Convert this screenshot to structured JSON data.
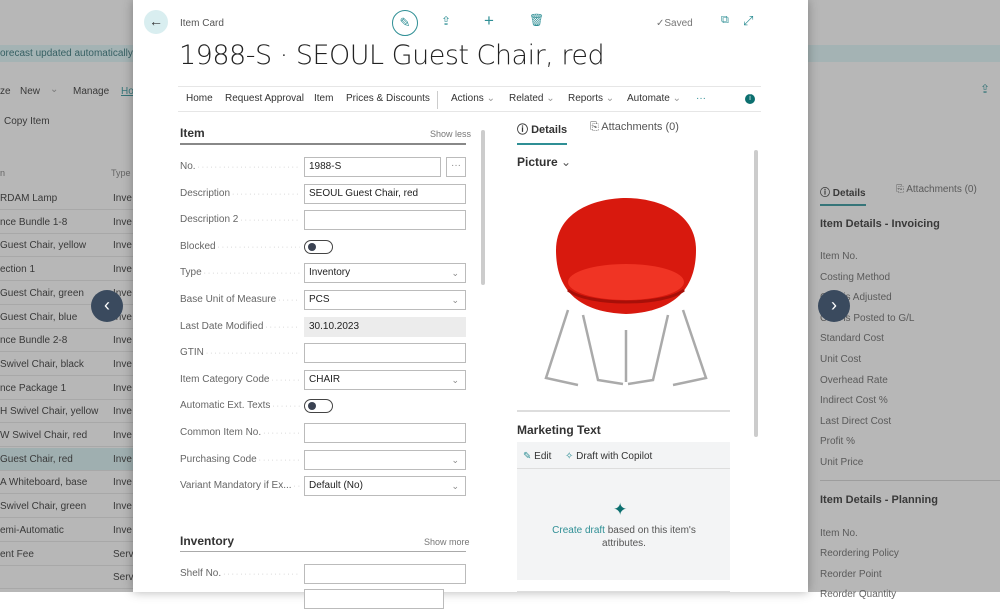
{
  "background_list": {
    "banner": "orecast updated automatically",
    "toolbar": [
      "ze",
      "New",
      "Manage",
      "Ho"
    ],
    "copy_item": "Copy Item",
    "columns": [
      "n",
      "Type"
    ],
    "rows": [
      {
        "d": "RDAM Lamp",
        "t": "Inve"
      },
      {
        "d": "nce Bundle 1-8",
        "t": "Inve"
      },
      {
        "d": "Guest Chair, yellow",
        "t": "Inve"
      },
      {
        "d": "ection 1",
        "t": "Inve"
      },
      {
        "d": "Guest Chair, green",
        "t": "Inve"
      },
      {
        "d": "Guest Chair, blue",
        "t": "Inve"
      },
      {
        "d": "nce Bundle 2-8",
        "t": "Inve"
      },
      {
        "d": "Swivel Chair, black",
        "t": "Inve"
      },
      {
        "d": "nce Package 1",
        "t": "Inve"
      },
      {
        "d": "H Swivel Chair, yellow",
        "t": "Inve"
      },
      {
        "d": "W Swivel Chair, red",
        "t": "Inve"
      },
      {
        "d": "Guest Chair, red",
        "t": "Inve"
      },
      {
        "d": "A Whiteboard, base",
        "t": "Inve"
      },
      {
        "d": "Swivel Chair, green",
        "t": "Inve"
      },
      {
        "d": "emi-Automatic",
        "t": "Inve"
      },
      {
        "d": "ent Fee",
        "t": "Serv"
      },
      {
        "d": "",
        "t": "Serv"
      }
    ]
  },
  "background_factbox": {
    "tabs": [
      "Details",
      "Attachments (0)"
    ],
    "invoicing_title": "Item Details - Invoicing",
    "invoicing_fields": [
      "Item No.",
      "Costing Method",
      "Cost is Adjusted",
      "Cost is Posted to G/L",
      "Standard Cost",
      "Unit Cost",
      "Overhead Rate",
      "Indirect Cost %",
      "Last Direct Cost",
      "Profit %",
      "Unit Price"
    ],
    "planning_title": "Item Details - Planning",
    "planning_fields": [
      "Item No.",
      "Reordering Policy",
      "Reorder Point",
      "Reorder Quantity"
    ]
  },
  "card": {
    "breadcrumb": "Item Card",
    "saved": "Saved",
    "title": "1988-S · SEOUL Guest Chair, red",
    "actions": [
      "Home",
      "Request Approval",
      "Item",
      "Prices & Discounts",
      "Actions",
      "Related",
      "Reports",
      "Automate"
    ],
    "more": "···",
    "item_section": {
      "title": "Item",
      "toggle": "Show less"
    },
    "fields": [
      {
        "label": "No.",
        "value": "1988-S",
        "kind": "lookup"
      },
      {
        "label": "Description",
        "value": "SEOUL Guest Chair, red",
        "kind": "text"
      },
      {
        "label": "Description 2",
        "value": "",
        "kind": "text"
      },
      {
        "label": "Blocked",
        "value": "off",
        "kind": "toggle"
      },
      {
        "label": "Type",
        "value": "Inventory",
        "kind": "select"
      },
      {
        "label": "Base Unit of Measure",
        "value": "PCS",
        "kind": "select"
      },
      {
        "label": "Last Date Modified",
        "value": "30.10.2023",
        "kind": "readonly"
      },
      {
        "label": "GTIN",
        "value": "",
        "kind": "text"
      },
      {
        "label": "Item Category Code",
        "value": "CHAIR",
        "kind": "select"
      },
      {
        "label": "Automatic Ext. Texts",
        "value": "off",
        "kind": "toggle"
      },
      {
        "label": "Common Item No.",
        "value": "",
        "kind": "text"
      },
      {
        "label": "Purchasing Code",
        "value": "",
        "kind": "select"
      },
      {
        "label": "Variant Mandatory if Ex...",
        "value": "Default (No)",
        "kind": "select"
      }
    ],
    "inventory_section": {
      "title": "Inventory",
      "toggle": "Show more"
    },
    "shelf_label": "Shelf No.",
    "factbox": {
      "tabs": [
        "Details",
        "Attachments (0)"
      ],
      "picture": "Picture",
      "marketing_title": "Marketing Text",
      "edit": "Edit",
      "copilot": "Draft with Copilot",
      "create_link": "Create draft",
      "create_rest": " based on this item's attributes."
    }
  },
  "colors": {
    "accent": "#2f8f95",
    "chair": "#e02418"
  }
}
